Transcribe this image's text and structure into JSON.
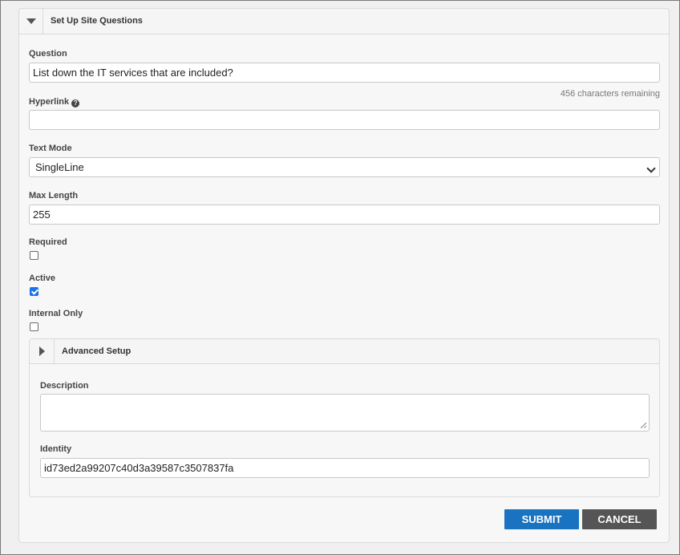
{
  "panel": {
    "title": "Set Up Site Questions"
  },
  "question": {
    "label": "Question",
    "value": "List down the IT services that are included?",
    "chars_remaining": "456 characters remaining"
  },
  "hyperlink": {
    "label": "Hyperlink",
    "value": "",
    "help_icon": "question-circle-icon"
  },
  "text_mode": {
    "label": "Text Mode",
    "selected": "SingleLine"
  },
  "max_length": {
    "label": "Max Length",
    "value": "255"
  },
  "required": {
    "label": "Required",
    "checked": false
  },
  "active": {
    "label": "Active",
    "checked": true
  },
  "internal_only": {
    "label": "Internal Only",
    "checked": false
  },
  "advanced": {
    "title": "Advanced Setup",
    "description": {
      "label": "Description",
      "value": ""
    },
    "identity": {
      "label": "Identity",
      "value": "id73ed2a99207c40d3a39587c3507837fa"
    }
  },
  "buttons": {
    "submit": "SUBMIT",
    "cancel": "CANCEL"
  },
  "colors": {
    "submit": "#1a73c0",
    "cancel": "#555555",
    "checkbox_checked": "#1a73e8"
  }
}
